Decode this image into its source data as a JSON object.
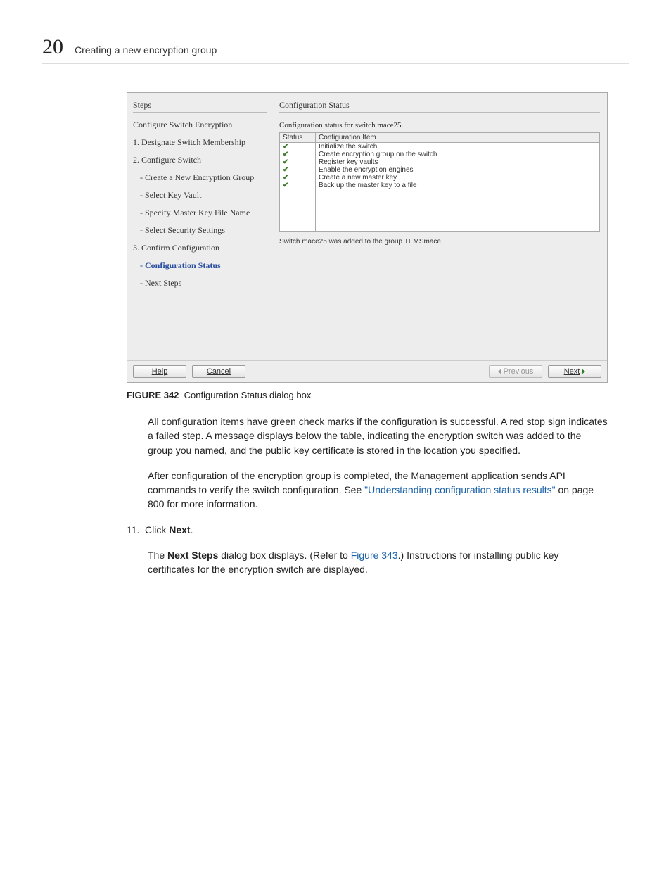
{
  "header": {
    "chapter_number": "20",
    "chapter_title": "Creating a new encryption group"
  },
  "dialog": {
    "steps_header": "Steps",
    "steps": {
      "s0": "Configure Switch Encryption",
      "s1": "1. Designate Switch Membership",
      "s2": "2. Configure Switch",
      "s2a": "- Create a New Encryption Group",
      "s2b": "- Select Key Vault",
      "s2c": "- Specify Master Key File Name",
      "s2d": "- Select Security Settings",
      "s3": "3. Confirm Configuration",
      "s3a": "- Configuration Status",
      "s3b": "- Next Steps"
    },
    "status_header": "Configuration Status",
    "status_caption": "Configuration status for switch mace25.",
    "table": {
      "col_status": "Status",
      "col_item": "Configuration Item",
      "rows": {
        "r0": "Initialize the switch",
        "r1": "Create encryption group on the switch",
        "r2": "Register key vaults",
        "r3": "Enable the encryption engines",
        "r4": "Create a new master key",
        "r5": "Back up the master key to a file"
      }
    },
    "status_msg": "Switch mace25 was added to the group TEMSmace.",
    "buttons": {
      "help": "Help",
      "cancel": "Cancel",
      "previous": "Previous",
      "next": "Next"
    }
  },
  "figure": {
    "label": "FIGURE 342",
    "caption": "Configuration Status dialog box"
  },
  "paragraphs": {
    "p1": "All configuration items have green check marks if the configuration is successful. A red stop sign indicates a failed step. A message displays below the table, indicating the encryption switch was added to the group you named, and the public key certificate is stored in the location you specified.",
    "p2a": "After configuration of the encryption group is completed, the Management application sends API commands to verify the switch configuration. See ",
    "p2link": "\"Understanding configuration status results\"",
    "p2b": " on page 800 for more information.",
    "step11_num": "11.",
    "step11_a": "Click ",
    "step11_b": "Next",
    "step11_c": ".",
    "p3a": "The ",
    "p3b": "Next Steps",
    "p3c": " dialog box displays. (Refer to ",
    "p3link": "Figure 343",
    "p3d": ".) Instructions for installing public key certificates for the encryption switch are displayed."
  }
}
